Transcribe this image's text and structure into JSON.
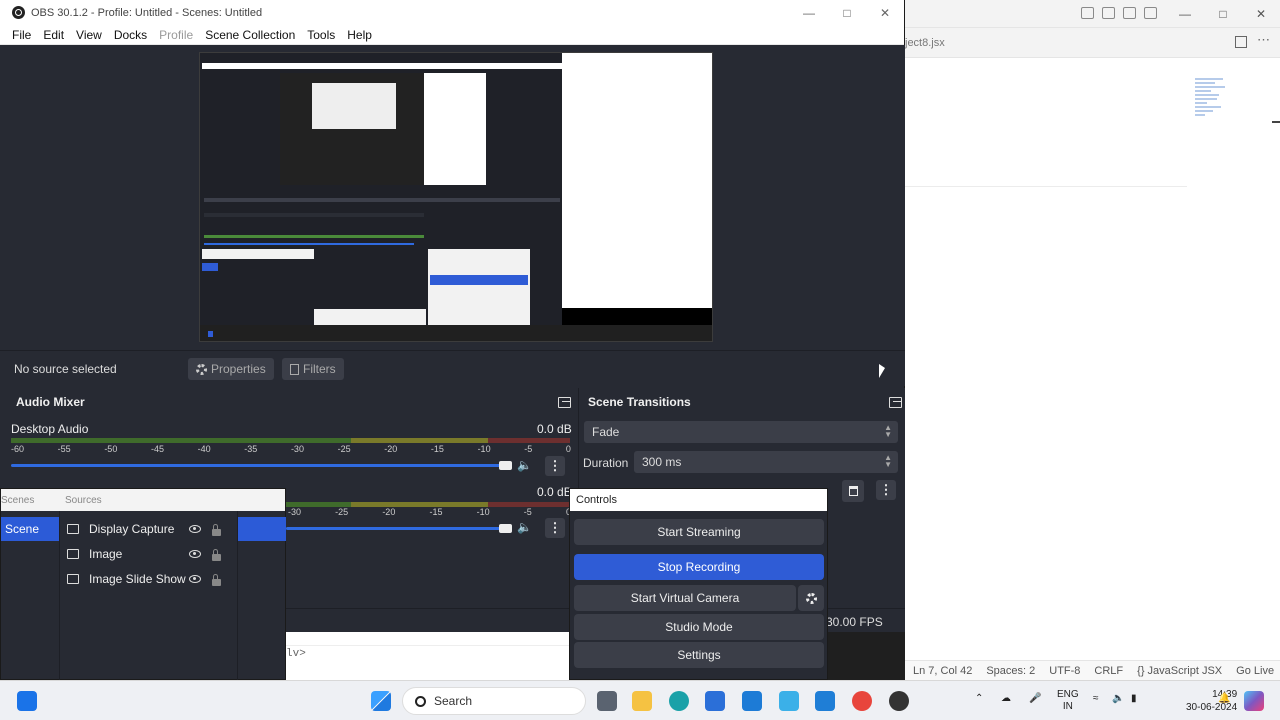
{
  "obs": {
    "title": "OBS 30.1.2 - Profile: Untitled - Scenes: Untitled",
    "menu": [
      "File",
      "Edit",
      "View",
      "Docks",
      "Profile",
      "Scene Collection",
      "Tools",
      "Help"
    ],
    "no_source": "No source selected",
    "properties": "Properties",
    "filters": "Filters",
    "fps": "30.00 FPS"
  },
  "audio_mixer": {
    "title": "Audio Mixer",
    "channels": [
      {
        "name": "Desktop Audio",
        "db": "0.0 dB"
      },
      {
        "name": "",
        "db": "0.0 dB"
      }
    ],
    "scale": [
      "-60",
      "-55",
      "-50",
      "-45",
      "-40",
      "-35",
      "-30",
      "-25",
      "-20",
      "-15",
      "-10",
      "-5",
      "0"
    ],
    "scale2": [
      "-30",
      "-25",
      "-20",
      "-15",
      "-10",
      "-5",
      "0"
    ]
  },
  "transitions": {
    "title": "Scene Transitions",
    "selected": "Fade",
    "duration_label": "Duration",
    "duration_value": "300 ms"
  },
  "scenes_panel": {
    "tab_scenes": "Scenes",
    "tab_sources": "Sources",
    "scene": "Scene",
    "sources": [
      "Display Capture",
      "Image",
      "Image Slide Show"
    ]
  },
  "controls": {
    "title": "Controls",
    "start_streaming": "Start Streaming",
    "stop_recording": "Stop Recording",
    "start_virtual_camera": "Start Virtual Camera",
    "studio_mode": "Studio Mode",
    "settings": "Settings"
  },
  "vscode": {
    "tab": "ject8.jsx",
    "status": [
      "Ln 7, Col 42",
      "Spaces: 2",
      "UTF-8",
      "CRLF",
      "{} JavaScript JSX",
      "Go Live"
    ]
  },
  "background_code": "lv>",
  "taskbar": {
    "search": "Search",
    "lang1": "ENG",
    "lang2": "IN",
    "time": "14:39",
    "date": "30-06-2024"
  },
  "colors": {
    "obs_bg": "#272a33",
    "accent_blue": "#2f5cd6",
    "button": "#3b3e48"
  }
}
